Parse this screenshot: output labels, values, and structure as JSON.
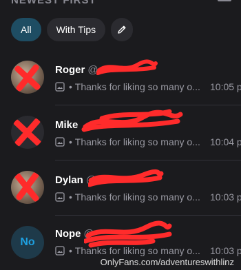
{
  "section": {
    "title": "NEWEST FIRST"
  },
  "filters": {
    "all_label": "All",
    "tips_label": "With Tips",
    "edit_icon": "pencil-icon"
  },
  "conversations": [
    {
      "name": "Roger",
      "handle": "@",
      "message": "Thanks for liking so many o...",
      "time": "10:05 p",
      "avatar_text": ""
    },
    {
      "name": "Mike",
      "handle": "",
      "message": "Thanks for liking so many o...",
      "time": "10:04 p",
      "avatar_text": ""
    },
    {
      "name": "Dylan",
      "handle": "@",
      "message": "Thanks for liking so many o...",
      "time": "10:03 p",
      "avatar_text": ""
    },
    {
      "name": "Nope",
      "handle": "@",
      "message": "Thanks for liking so many o...",
      "time": "10:03 p",
      "avatar_text": "No"
    }
  ],
  "message_separator": "•",
  "watermark": "OnlyFans.com/adventureswithlinz",
  "colors": {
    "background": "#1b1b1e",
    "active_chip": "#1e4d63",
    "redaction": "#ff2b2b",
    "initials_text": "#1ea0e0"
  }
}
